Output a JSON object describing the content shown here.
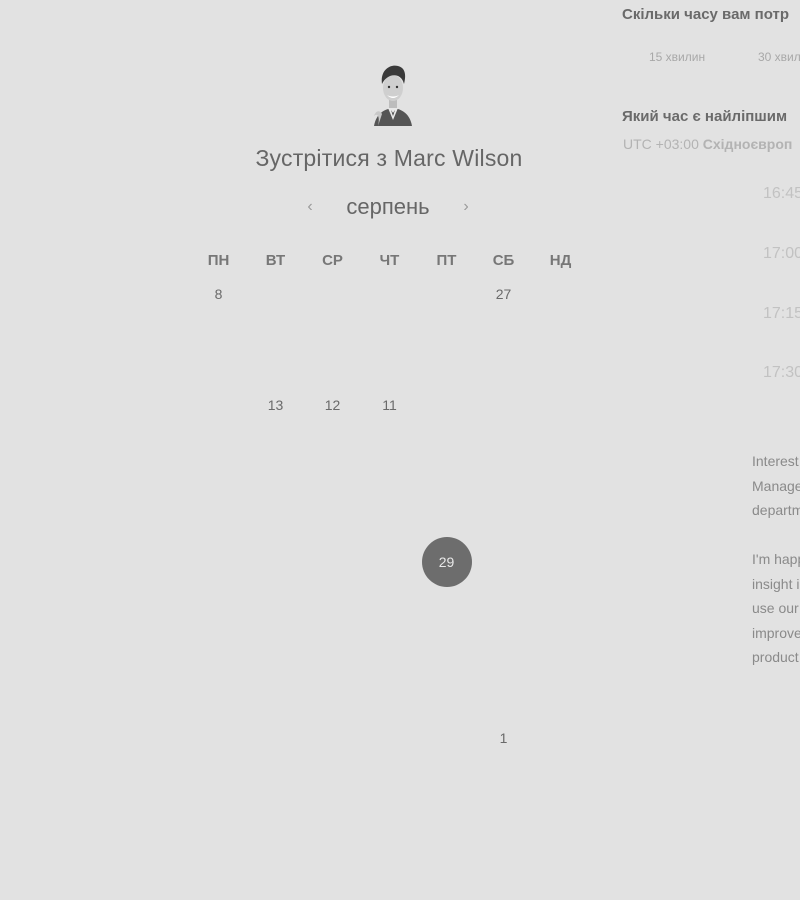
{
  "host": {
    "meet_title": "Зустрітися з Marc Wilson"
  },
  "calendar": {
    "month": "серпень",
    "prev_icon": "chevron-left-icon",
    "next_icon": "chevron-right-icon",
    "weekdays": [
      "ПН",
      "ВТ",
      "СР",
      "ЧТ",
      "ПТ",
      "СБ",
      "НД"
    ],
    "rows": [
      [
        "8",
        "",
        "",
        "",
        "",
        "27",
        ""
      ],
      [
        "",
        "13",
        "12",
        "11",
        "",
        "",
        ""
      ],
      [
        "",
        "",
        "",
        "",
        "29",
        "",
        ""
      ],
      [
        "",
        "",
        "",
        "",
        "",
        "",
        ""
      ],
      [
        "",
        "",
        "",
        "",
        "",
        "1",
        ""
      ]
    ],
    "selected_day": "29"
  },
  "panel": {
    "duration_question": "Скільки часу вам потр",
    "durations": [
      "15 хвилин",
      "30 хвил"
    ],
    "time_question": "Який час є найліпшим",
    "timezone_offset": "UTC +03:00",
    "timezone_name": "Східноєвроп",
    "slots": [
      "16:45",
      "17:00",
      "17:15",
      "17:30"
    ],
    "description_p1": [
      "Interest",
      "Manage",
      "departm"
    ],
    "description_p2": [
      "I'm happ",
      "insight i",
      "use our",
      "improve",
      "product"
    ]
  },
  "colors": {
    "background": "#e2e2e2",
    "selected_day_bg": "#6d6d6d"
  }
}
